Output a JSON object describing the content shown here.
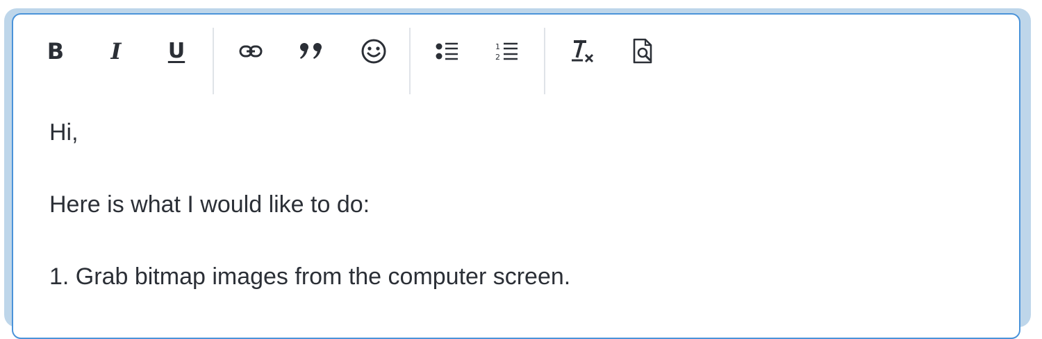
{
  "toolbar": {
    "buttons": [
      {
        "name": "bold",
        "glyph": "B",
        "icon": "bold-icon"
      },
      {
        "name": "italic",
        "glyph": "I",
        "icon": "italic-icon"
      },
      {
        "name": "underline",
        "glyph": "U",
        "icon": "underline-icon"
      },
      {
        "name": "link",
        "icon": "link-icon"
      },
      {
        "name": "blockquote",
        "icon": "quote-icon"
      },
      {
        "name": "emoji",
        "icon": "smiley-icon"
      },
      {
        "name": "bulleted-list",
        "icon": "bulleted-list-icon"
      },
      {
        "name": "numbered-list",
        "icon": "numbered-list-icon"
      },
      {
        "name": "remove-format",
        "icon": "clear-formatting-icon"
      },
      {
        "name": "preview",
        "icon": "document-preview-icon"
      }
    ]
  },
  "content": {
    "lines": [
      "Hi,",
      "Here is what I would like to do:",
      "1. Grab bitmap images from the computer screen."
    ]
  },
  "colors": {
    "focus_border": "#4a93d9",
    "focus_ring": "#bed6ea",
    "text": "#2b2f36",
    "separator": "#dfe3e8"
  }
}
